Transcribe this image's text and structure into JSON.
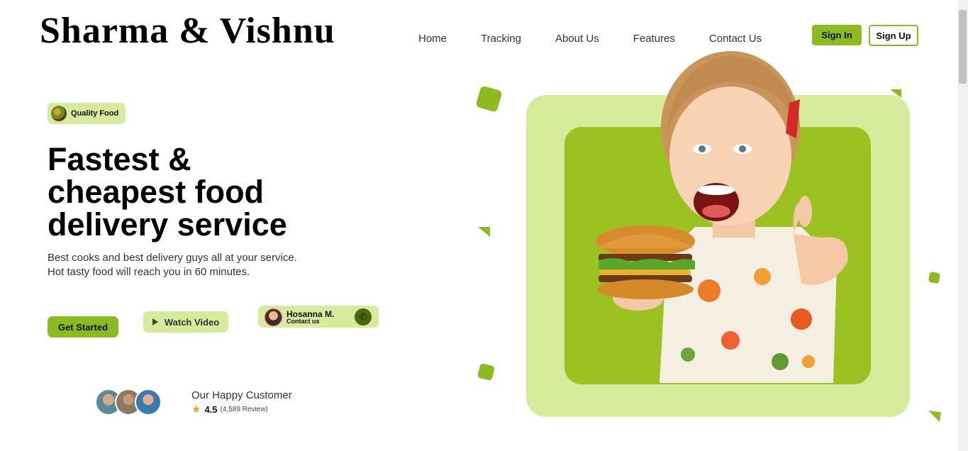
{
  "brand": {
    "logo": "Sharma & Vishnu"
  },
  "nav": {
    "items": [
      {
        "label": "Home"
      },
      {
        "label": "Tracking"
      },
      {
        "label": "About Us"
      },
      {
        "label": "Features"
      },
      {
        "label": "Contact Us"
      }
    ]
  },
  "auth": {
    "sign_in": "Sign In",
    "sign_up": "Sign Up"
  },
  "hero": {
    "badge": "Quality Food",
    "headline_lines": [
      "Fastest &",
      "cheapest food",
      "delivery service"
    ],
    "subtitle_lines": [
      "Best cooks and best delivery guys all at your service.",
      "Hot tasty food will reach you in 60 minutes."
    ],
    "get_started": "Get Started",
    "watch_video": "Watch Video",
    "contact": {
      "name": "Hosanna M.",
      "role": "Contact us",
      "icon": "phone-icon"
    }
  },
  "customers": {
    "title": "Our Happy Customer",
    "rating": "4.5",
    "reviews": "(4,589 Review)",
    "rating_icon": "star-icon"
  },
  "colors": {
    "accent": "#8cbb1f",
    "accent_light": "#d6eb9b",
    "hero_dark": "#9cc222"
  }
}
